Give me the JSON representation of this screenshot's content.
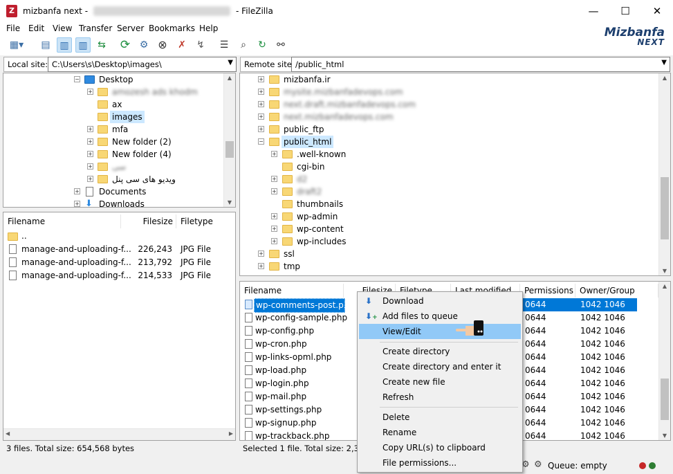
{
  "window": {
    "title": "mizbanfa next",
    "title_blur": "draftmizbanfadev@88.135.68.26",
    "app": "FileZilla",
    "minimize": "—",
    "maximize": "☐",
    "close": "✕"
  },
  "menu": [
    "File",
    "Edit",
    "View",
    "Transfer",
    "Server",
    "Bookmarks",
    "Help"
  ],
  "logo": {
    "line1": "Mizbanfa",
    "line2": "NEXT"
  },
  "local": {
    "label": "Local site:",
    "path": "C:\\Users\\s\\Desktop\\images\\",
    "tree": [
      {
        "name": "Desktop",
        "blur": false,
        "sel": false
      },
      {
        "name": "amozesh ads khodm",
        "blur": true
      },
      {
        "name": "ax",
        "blur": false
      },
      {
        "name": "images",
        "blur": false,
        "sel": true
      },
      {
        "name": "mfa",
        "blur": false
      },
      {
        "name": "New folder (2)",
        "blur": false
      },
      {
        "name": "New folder (4)",
        "blur": false
      },
      {
        "name": "سی",
        "blur": true
      },
      {
        "name": "ویدیو های سی پنل",
        "blur": false
      },
      {
        "name": "Documents",
        "blur": false
      },
      {
        "name": "Downloads",
        "blur": false
      }
    ],
    "headers": {
      "filename": "Filename",
      "filesize": "Filesize",
      "filetype": "Filetype"
    },
    "files": [
      {
        "name": "..",
        "size": "",
        "type": ""
      },
      {
        "name": "manage-and-uploading-f...",
        "size": "226,243",
        "type": "JPG File"
      },
      {
        "name": "manage-and-uploading-f...",
        "size": "213,792",
        "type": "JPG File"
      },
      {
        "name": "manage-and-uploading-f...",
        "size": "214,533",
        "type": "JPG File"
      }
    ],
    "status": "3 files. Total size: 654,568 bytes"
  },
  "remote": {
    "label": "Remote site:",
    "path": "/public_html",
    "tree": [
      {
        "name": "mizbanfa.ir",
        "blur": false
      },
      {
        "name": "mysite.mizbanfadevops.com",
        "blur": true
      },
      {
        "name": "next.draft.mizbanfadevops.com",
        "blur": true
      },
      {
        "name": "next.mizbanfadevops.com",
        "blur": true
      },
      {
        "name": "public_ftp",
        "blur": false
      },
      {
        "name": "public_html",
        "blur": false,
        "sel": true
      },
      {
        "name": ".well-known",
        "blur": false
      },
      {
        "name": "cgi-bin",
        "blur": false
      },
      {
        "name": "d2",
        "blur": true
      },
      {
        "name": "draft2",
        "blur": true
      },
      {
        "name": "thumbnails",
        "blur": false
      },
      {
        "name": "wp-admin",
        "blur": false
      },
      {
        "name": "wp-content",
        "blur": false
      },
      {
        "name": "wp-includes",
        "blur": false
      },
      {
        "name": "ssl",
        "blur": false
      },
      {
        "name": "tmp",
        "blur": false
      }
    ],
    "headers": {
      "filename": "Filename",
      "filesize": "Filesize",
      "filetype": "Filetype",
      "modified": "Last modified",
      "permissions": "Permissions",
      "owner": "Owner/Group"
    },
    "files": [
      {
        "name": "wp-comments-post.p...",
        "perm": "0644",
        "owner": "1042 1046",
        "sel": true
      },
      {
        "name": "wp-config-sample.php",
        "perm": "0644",
        "owner": "1042 1046"
      },
      {
        "name": "wp-config.php",
        "perm": "0644",
        "owner": "1042 1046"
      },
      {
        "name": "wp-cron.php",
        "perm": "0644",
        "owner": "1042 1046"
      },
      {
        "name": "wp-links-opml.php",
        "perm": "0644",
        "owner": "1042 1046"
      },
      {
        "name": "wp-load.php",
        "perm": "0644",
        "owner": "1042 1046"
      },
      {
        "name": "wp-login.php",
        "perm": "0644",
        "owner": "1042 1046"
      },
      {
        "name": "wp-mail.php",
        "perm": "0644",
        "owner": "1042 1046"
      },
      {
        "name": "wp-settings.php",
        "perm": "0644",
        "owner": "1042 1046"
      },
      {
        "name": "wp-signup.php",
        "perm": "0644",
        "owner": "1042 1046"
      },
      {
        "name": "wp-trackback.php",
        "perm": "0644",
        "owner": "1042 1046"
      }
    ],
    "status": "Selected 1 file. Total size: 2,323 b"
  },
  "queue": {
    "label": "Queue: empty"
  },
  "context_menu": {
    "items": [
      "Download",
      "Add files to queue",
      "View/Edit",
      "Create directory",
      "Create directory and enter it",
      "Create new file",
      "Refresh",
      "Delete",
      "Rename",
      "Copy URL(s) to clipboard",
      "File permissions..."
    ],
    "highlighted": "View/Edit"
  }
}
